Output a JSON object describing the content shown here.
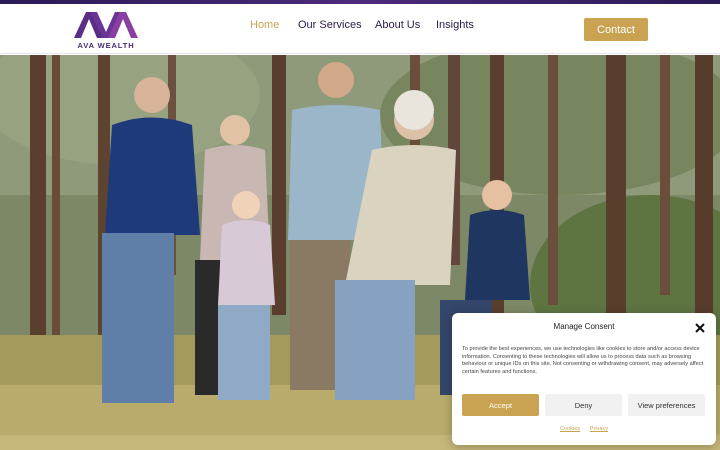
{
  "brand": {
    "name": "AVA WEALTH",
    "colors": {
      "gold": "#c9a352",
      "purple": "#4a2b74",
      "navy": "#2a1b4a"
    }
  },
  "nav": {
    "items": [
      {
        "label": "Home",
        "active": true
      },
      {
        "label": "Our Services",
        "active": false
      },
      {
        "label": "About Us",
        "active": false
      },
      {
        "label": "Insights",
        "active": false
      }
    ],
    "contact_label": "Contact"
  },
  "hero": {
    "image": "family walking hand in hand through a forest"
  },
  "consent": {
    "title": "Manage Consent",
    "text": "To provide the best experiences, we use technologies like cookies to store and/or access device information. Consenting to these technologies will allow us to process data such as browsing behaviour or unique IDs on this site. Not consenting or withdrawing consent, may adversely affect certain features and functions.",
    "accept_label": "Accept",
    "deny_label": "Deny",
    "preferences_label": "View preferences",
    "links": [
      "Cookies",
      "Privacy"
    ]
  }
}
